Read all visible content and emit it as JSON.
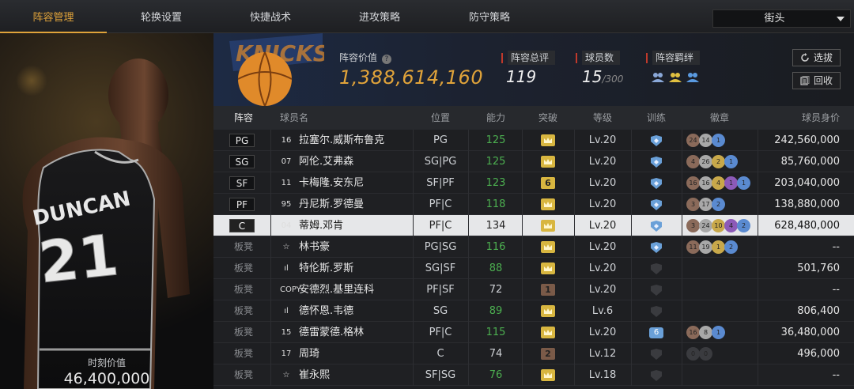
{
  "tabs": [
    {
      "label": "阵容管理",
      "active": true
    },
    {
      "label": "轮换设置",
      "active": false
    },
    {
      "label": "快捷战术",
      "active": false
    },
    {
      "label": "进攻策略",
      "active": false
    },
    {
      "label": "防守策略",
      "active": false
    }
  ],
  "mode_select": {
    "value": "街头"
  },
  "player_card": {
    "moment_label": "时刻价值",
    "moment_value": "46,400,000",
    "jersey_name": "DUNCAN",
    "jersey_number": "21"
  },
  "summary": {
    "value_label": "阵容价值",
    "value": "1,388,614,160",
    "rating_label": "阵容总评",
    "rating": "119",
    "count_label": "球员数",
    "count": "15",
    "count_max": "/300",
    "bond_label": "阵容羁绊"
  },
  "buttons": {
    "select_label": "选拔",
    "recycle_label": "回收"
  },
  "columns": [
    "阵容",
    "球员名",
    "位置",
    "能力",
    "突破",
    "等级",
    "训练",
    "徽章",
    "球员身价"
  ],
  "colors": {
    "accent": "#e0a33a",
    "green": "#4caf50",
    "selected_row": "#e6e7e9",
    "badge_bronze": "#8a6a5a",
    "badge_silver": "#a8a8a8",
    "badge_gold": "#c8a84a",
    "badge_purple": "#8c5ab8",
    "badge_blue": "#5a8ad0"
  },
  "rows": [
    {
      "slot": "PG",
      "num": "16",
      "name": "拉塞尔.威斯布鲁克",
      "position": "PG",
      "rating": "125",
      "rating_green": true,
      "breakthrough": "crown",
      "level": "Lv.20",
      "train": "shield",
      "badges": [
        [
          "24",
          "bronze"
        ],
        [
          "14",
          "silver"
        ],
        [
          "1",
          "blue"
        ]
      ],
      "value": "242,560,000"
    },
    {
      "slot": "SG",
      "num": "07",
      "name": "阿伦.艾弗森",
      "position": "SG|PG",
      "rating": "125",
      "rating_green": true,
      "breakthrough": "crown",
      "level": "Lv.20",
      "train": "shield",
      "badges": [
        [
          "4",
          "bronze"
        ],
        [
          "26",
          "silver"
        ],
        [
          "2",
          "gold"
        ],
        [
          "1",
          "blue"
        ]
      ],
      "value": "85,760,000"
    },
    {
      "slot": "SF",
      "num": "11",
      "name": "卡梅隆.安东尼",
      "position": "SF|PF",
      "rating": "123",
      "rating_green": true,
      "breakthrough": "6",
      "level": "Lv.20",
      "train": "shield",
      "badges": [
        [
          "16",
          "bronze"
        ],
        [
          "16",
          "silver"
        ],
        [
          "4",
          "gold"
        ],
        [
          "1",
          "purple"
        ],
        [
          "1",
          "blue"
        ]
      ],
      "value": "203,040,000"
    },
    {
      "slot": "PF",
      "num": "95",
      "name": "丹尼斯.罗德曼",
      "position": "PF|C",
      "rating": "118",
      "rating_green": true,
      "breakthrough": "crown",
      "level": "Lv.20",
      "train": "shield",
      "badges": [
        [
          "3",
          "bronze"
        ],
        [
          "17",
          "silver"
        ],
        [
          "2",
          "blue"
        ]
      ],
      "value": "138,880,000"
    },
    {
      "slot": "C",
      "num": "04",
      "name": "蒂姆.邓肯",
      "position": "PF|C",
      "rating": "134",
      "rating_green": false,
      "breakthrough": "crown",
      "level": "Lv.20",
      "train": "shield",
      "badges": [
        [
          "3",
          "bronze"
        ],
        [
          "24",
          "silver"
        ],
        [
          "10",
          "gold"
        ],
        [
          "4",
          "purple"
        ],
        [
          "2",
          "blue"
        ]
      ],
      "value": "628,480,000",
      "selected": true
    },
    {
      "slot": "板凳",
      "num": "☆",
      "name": "林书豪",
      "position": "PG|SG",
      "rating": "116",
      "rating_green": true,
      "breakthrough": "crown",
      "level": "Lv.20",
      "train": "shield",
      "badges": [
        [
          "11",
          "bronze"
        ],
        [
          "19",
          "silver"
        ],
        [
          "1",
          "gold"
        ],
        [
          "2",
          "blue"
        ]
      ],
      "value": "--"
    },
    {
      "slot": "板凳",
      "num": "ıl",
      "name": "特伦斯.罗斯",
      "position": "SG|SF",
      "rating": "88",
      "rating_green": true,
      "breakthrough": "crown",
      "level": "Lv.20",
      "train": "dark",
      "badges": [],
      "value": "501,760"
    },
    {
      "slot": "板凳",
      "num": "COPY",
      "name": "安德烈.基里连科",
      "position": "PF|SF",
      "rating": "72",
      "rating_green": false,
      "breakthrough": "1",
      "level": "Lv.20",
      "train": "dark",
      "badges": [],
      "value": "--"
    },
    {
      "slot": "板凳",
      "num": "ıl",
      "name": "德怀恩.韦德",
      "position": "SG",
      "rating": "89",
      "rating_green": true,
      "breakthrough": "crown",
      "level": "Lv.6",
      "train": "dark",
      "badges": [],
      "value": "806,400"
    },
    {
      "slot": "板凳",
      "num": "15",
      "name": "德雷蒙德.格林",
      "position": "PF|C",
      "rating": "115",
      "rating_green": true,
      "breakthrough": "crown",
      "level": "Lv.20",
      "train": "6",
      "badges": [
        [
          "16",
          "bronze"
        ],
        [
          "8",
          "silver"
        ],
        [
          "1",
          "blue"
        ]
      ],
      "value": "36,480,000"
    },
    {
      "slot": "板凳",
      "num": "17",
      "name": "周琦",
      "position": "C",
      "rating": "74",
      "rating_green": false,
      "breakthrough": "2",
      "level": "Lv.12",
      "train": "dark",
      "badges": [
        [
          "0",
          "dark"
        ],
        [
          "0",
          "dark"
        ]
      ],
      "value": "496,000"
    },
    {
      "slot": "板凳",
      "num": "☆",
      "name": "崔永熙",
      "position": "SF|SG",
      "rating": "76",
      "rating_green": true,
      "breakthrough": "crown",
      "level": "Lv.18",
      "train": "dark",
      "badges": [],
      "value": "--"
    }
  ]
}
